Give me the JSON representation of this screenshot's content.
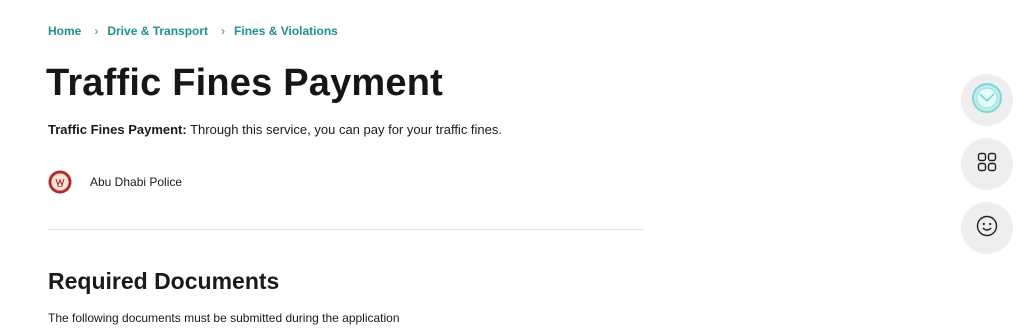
{
  "breadcrumb": {
    "items": [
      "Home",
      "Drive & Transport",
      "Fines & Violations"
    ],
    "separator": "›"
  },
  "page": {
    "title": "Traffic Fines Payment",
    "description_bold": "Traffic Fines Payment:",
    "description_rest": " Through this service, you can pay for your traffic fines."
  },
  "provider": {
    "name": "Abu Dhabi Police",
    "logo_icon": "abu-dhabi-police-emblem"
  },
  "required_documents": {
    "title": "Required Documents",
    "subtitle": "The following documents must be submitted during the application"
  },
  "floating_actions": [
    {
      "icon": "assistant-chat-icon"
    },
    {
      "icon": "apps-grid-icon"
    },
    {
      "icon": "smiley-feedback-icon"
    }
  ],
  "colors": {
    "link": "#1f8f8f",
    "assistant_accent": "#7fd6d8",
    "button_bg": "#eeeeee",
    "logo_red": "#b3262f"
  }
}
